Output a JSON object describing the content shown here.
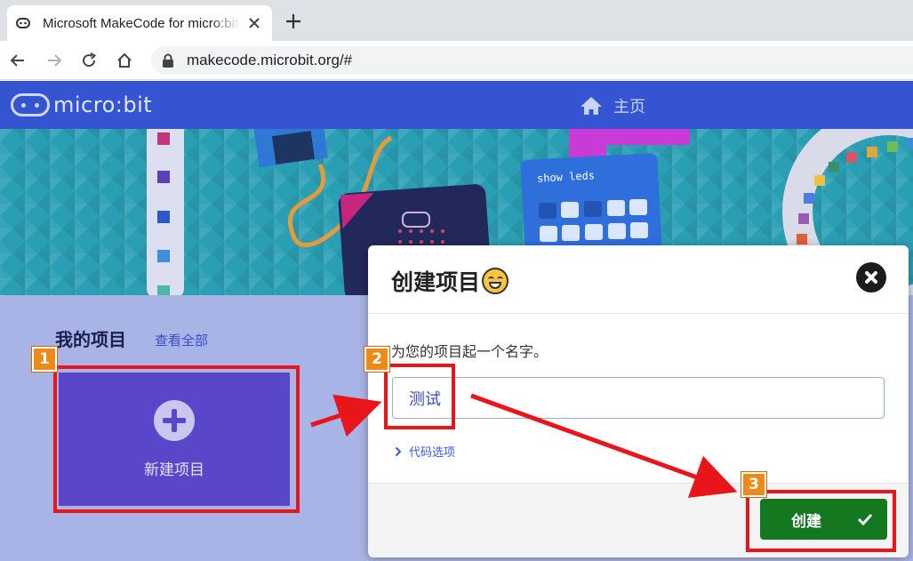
{
  "browser": {
    "tab_title": "Microsoft MakeCode for micro:bit",
    "url": "makecode.microbit.org/#"
  },
  "app": {
    "logo_text": "micro:bit",
    "home_label": "主页"
  },
  "hero": {
    "block_text": "show leds"
  },
  "projects": {
    "title": "我的项目",
    "view_all": "查看全部",
    "new_project_label": "新建项目"
  },
  "modal": {
    "title": "创建项目",
    "prompt": "为您的项目起一个名字。",
    "name_value": "测试",
    "code_options": "代码选项",
    "create_label": "创建"
  },
  "annotations": {
    "badges": [
      "1",
      "2",
      "3"
    ]
  },
  "colors": {
    "header": "#3454d1",
    "new_project_tile": "#5a46c9",
    "create_button": "#13781f",
    "annotation_red": "#e8151b",
    "badge_orange": "#ee8a17"
  }
}
